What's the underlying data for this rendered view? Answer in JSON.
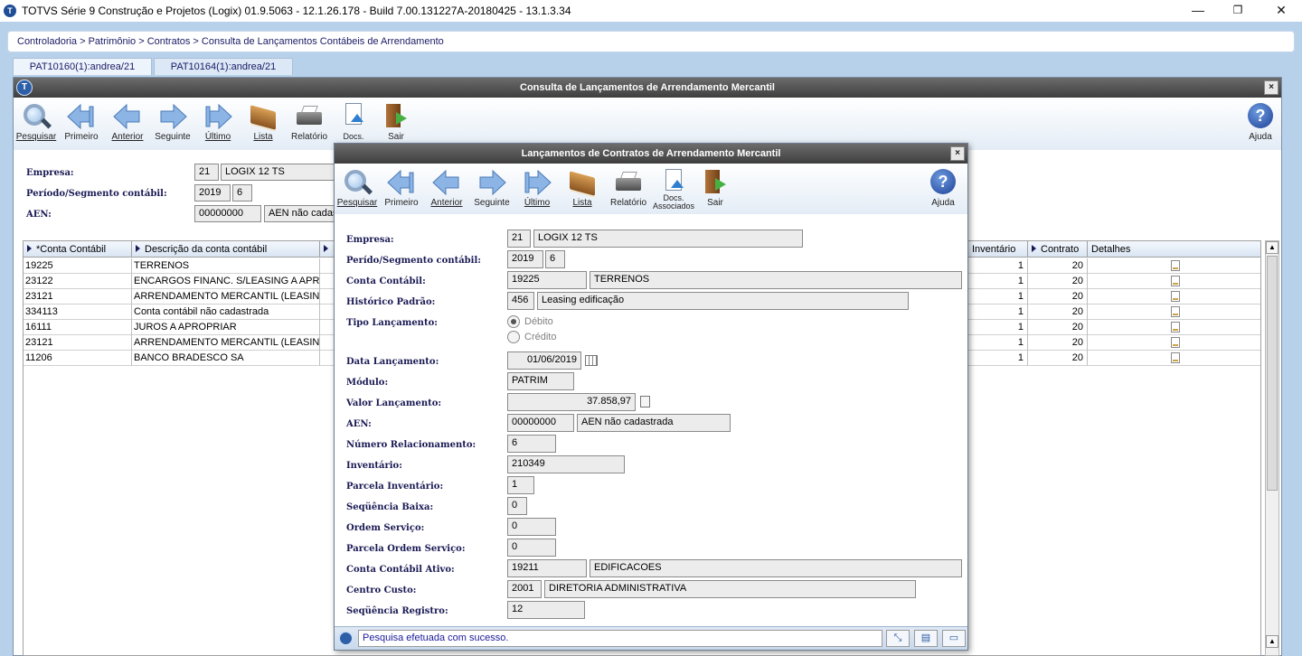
{
  "window": {
    "title": "TOTVS Série 9 Construção e Projetos (Logix) 01.9.5063 - 12.1.26.178 - Build 7.00.131227A-20180425 - 13.1.3.34",
    "minimize": "—",
    "restore": "❐",
    "close": "✕"
  },
  "breadcrumb": "Controladoria > Patrimônio > Contratos > Consulta de Lançamentos Contábeis de Arrendamento",
  "tabs": [
    {
      "label": "PAT10160(1):andrea/21"
    },
    {
      "label": "PAT10164(1):andrea/21"
    }
  ],
  "outer": {
    "title": "Consulta de Lançamentos de Arrendamento Mercantil",
    "close": "×",
    "toolbar": {
      "pesquisar": "Pesquisar",
      "primeiro": "Primeiro",
      "anterior": "Anterior",
      "seguinte": "Seguinte",
      "ultimo": "Último",
      "lista": "Lista",
      "relatorio": "Relatório",
      "docs": "Docs.",
      "sair": "Sair",
      "ajuda": "Ajuda"
    },
    "form": {
      "empresa_label": "Empresa:",
      "empresa_code": "21",
      "empresa_name": "LOGIX 12 TS",
      "periodo_label": "Período/Segmento contábil:",
      "periodo": "2019",
      "segmento": "6",
      "aen_label": "AEN:",
      "aen_code": "00000000",
      "aen_name": "AEN não cadas"
    },
    "grid": {
      "headers": {
        "conta": "*Conta Contábil",
        "descricao": "Descrição da conta contábil",
        "inventario": "Inventário",
        "contrato": "Contrato",
        "detalhes": "Detalhes"
      },
      "rows": [
        {
          "conta": "19225",
          "descricao": "TERRENOS",
          "inventario": "1",
          "contrato": "20"
        },
        {
          "conta": "23122",
          "descricao": "ENCARGOS FINANC. S/LEASING A APROP",
          "inventario": "1",
          "contrato": "20"
        },
        {
          "conta": "23121",
          "descricao": "ARRENDAMENTO MERCANTIL (LEASING)",
          "inventario": "1",
          "contrato": "20"
        },
        {
          "conta": "334113",
          "descricao": "Conta contábil não cadastrada",
          "inventario": "1",
          "contrato": "20"
        },
        {
          "conta": "16111",
          "descricao": "JUROS A APROPRIAR",
          "inventario": "1",
          "contrato": "20"
        },
        {
          "conta": "23121",
          "descricao": "ARRENDAMENTO MERCANTIL (LEASING)",
          "inventario": "1",
          "contrato": "20"
        },
        {
          "conta": "11206",
          "descricao": "BANCO BRADESCO SA",
          "inventario": "1",
          "contrato": "20"
        }
      ]
    }
  },
  "modal": {
    "title": "Lançamentos de Contratos de Arrendamento Mercantil",
    "close": "×",
    "toolbar": {
      "pesquisar": "Pesquisar",
      "primeiro": "Primeiro",
      "anterior": "Anterior",
      "seguinte": "Seguinte",
      "ultimo": "Último",
      "lista": "Lista",
      "relatorio": "Relatório",
      "docs": "Docs.",
      "docs2": "Associados",
      "sair": "Sair",
      "ajuda": "Ajuda"
    },
    "fields": {
      "empresa_label": "Empresa:",
      "empresa_code": "21",
      "empresa_name": "LOGIX 12 TS",
      "periodo_label": "Perído/Segmento contábil:",
      "periodo": "2019",
      "segmento": "6",
      "conta_label": "Conta Contábil:",
      "conta_code": "19225",
      "conta_name": "TERRENOS",
      "historico_label": "Histórico Padrão:",
      "historico_code": "456",
      "historico_name": "Leasing edificação",
      "tipo_label": "Tipo Lançamento:",
      "debito": "Débito",
      "credito": "Crédito",
      "data_label": "Data Lançamento:",
      "data": "01/06/2019",
      "modulo_label": "Módulo:",
      "modulo": "PATRIM",
      "valor_label": "Valor Lançamento:",
      "valor": "37.858,97",
      "aen_label": "AEN:",
      "aen_code": "00000000",
      "aen_name": "AEN não cadastrada",
      "numrel_label": "Número Relacionamento:",
      "numrel": "6",
      "inventario_label": "Inventário:",
      "inventario": "210349",
      "parcinv_label": "Parcela Inventário:",
      "parcinv": "1",
      "seqbaixa_label": "Seqüência Baixa:",
      "seqbaixa": "0",
      "ordem_label": "Ordem Serviço:",
      "ordem": "0",
      "parcordem_label": "Parcela Ordem Serviço:",
      "parcordem": "0",
      "contaativo_label": "Conta Contábil Ativo:",
      "contaativo_code": "19211",
      "contaativo_name": "EDIFICACOES",
      "centro_label": "Centro Custo:",
      "centro_code": "2001",
      "centro_name": "DIRETORIA ADMINISTRATIVA",
      "seqreg_label": "Seqüência Registro:",
      "seqreg": "12"
    },
    "status": "Pesquisa efetuada com sucesso."
  }
}
